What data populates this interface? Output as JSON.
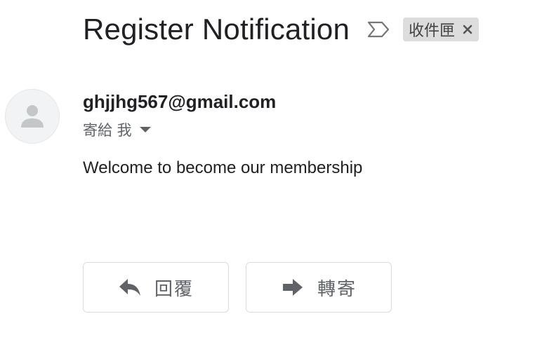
{
  "email": {
    "subject": "Register Notification",
    "label": "收件匣",
    "sender": "ghjjhg567@gmail.com",
    "recipient_text": "寄給 我",
    "body": "Welcome to become our membership"
  },
  "actions": {
    "reply_label": "回覆",
    "forward_label": "轉寄"
  },
  "icons": {
    "importance": "importance-marker-icon",
    "label_close": "close-icon",
    "avatar": "person-icon",
    "recipient_dropdown": "caret-down-icon",
    "reply": "reply-arrow-icon",
    "forward": "forward-arrow-icon"
  },
  "colors": {
    "text_primary": "#202124",
    "text_secondary": "#5f6368",
    "chip_bg": "#dddddd",
    "button_border": "#dadce0"
  }
}
